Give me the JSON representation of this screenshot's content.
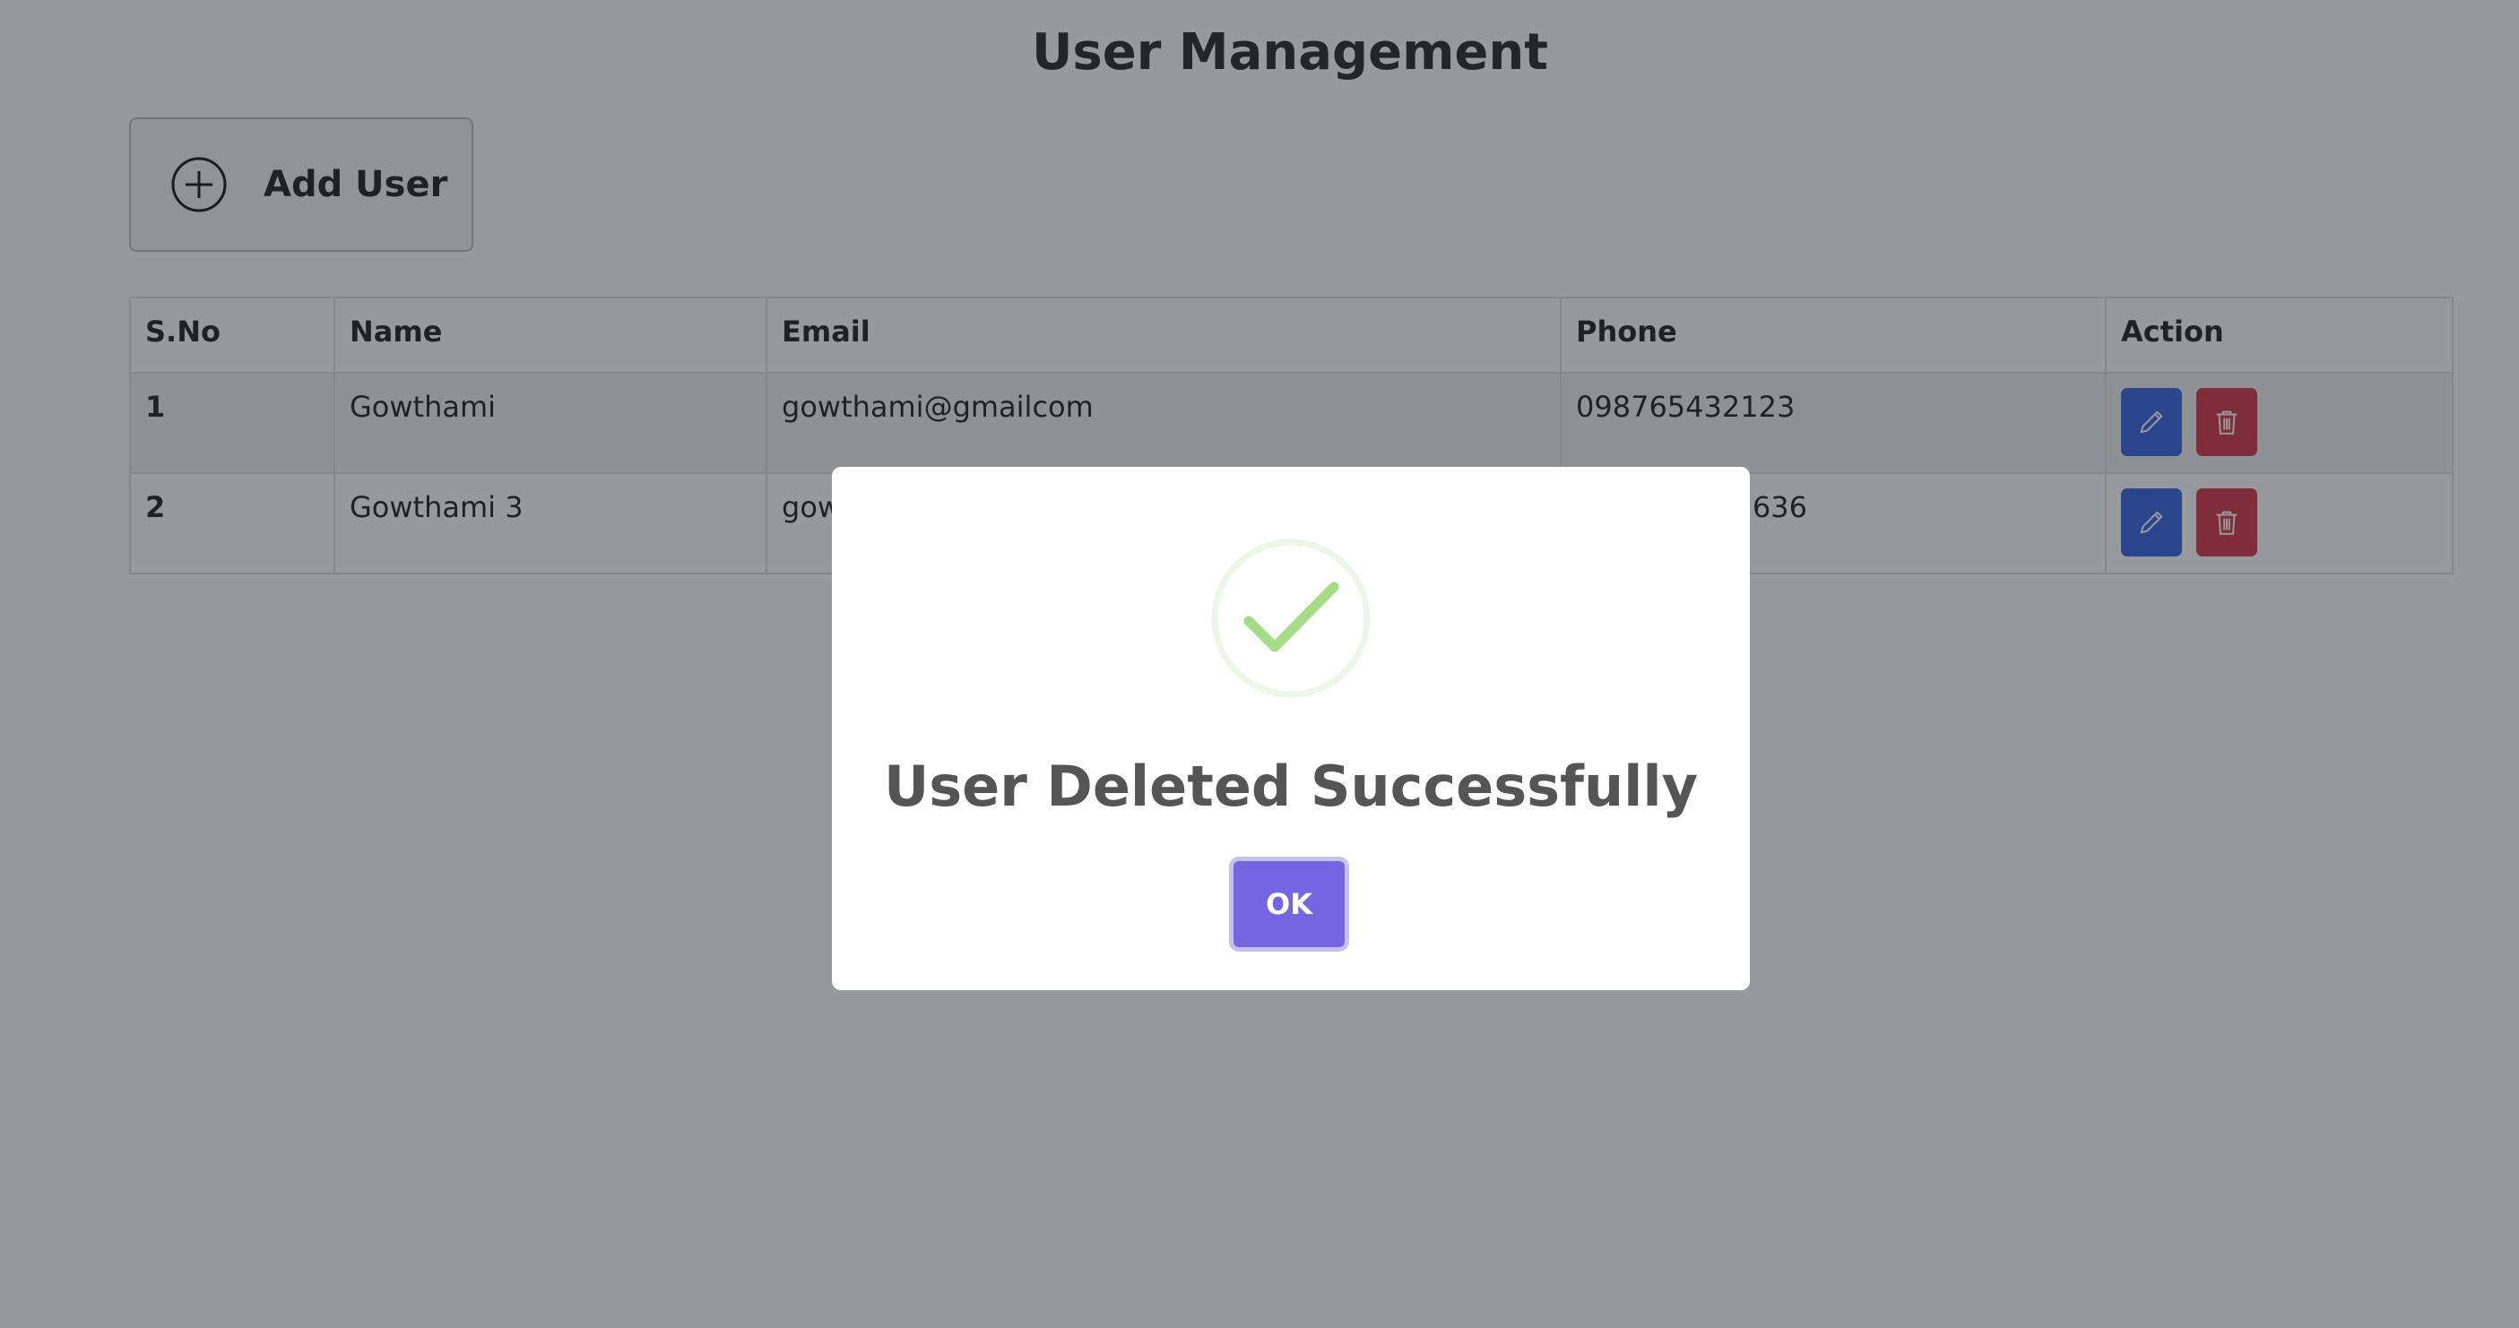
{
  "page": {
    "title": "User Management"
  },
  "toolbar": {
    "add_user_label": "Add User"
  },
  "table": {
    "headers": [
      "S.No",
      "Name",
      "Email",
      "Phone",
      "Action"
    ],
    "rows": [
      {
        "sno": "1",
        "name": "Gowthami",
        "email": "gowthami@gmailcom",
        "phone": "098765432123"
      },
      {
        "sno": "2",
        "name": "Gowthami 3",
        "email": "gow",
        "phone": "636"
      }
    ]
  },
  "modal": {
    "title": "User Deleted Successfully",
    "ok_label": "OK",
    "icon": "success-check-icon"
  },
  "colors": {
    "edit": "#2e5fe0",
    "delete": "#cf3040",
    "ok": "#7466e0",
    "success": "#a5dc86"
  },
  "icons": {
    "add": "plus-circle-icon",
    "edit": "pencil-icon",
    "delete": "trash-icon"
  }
}
